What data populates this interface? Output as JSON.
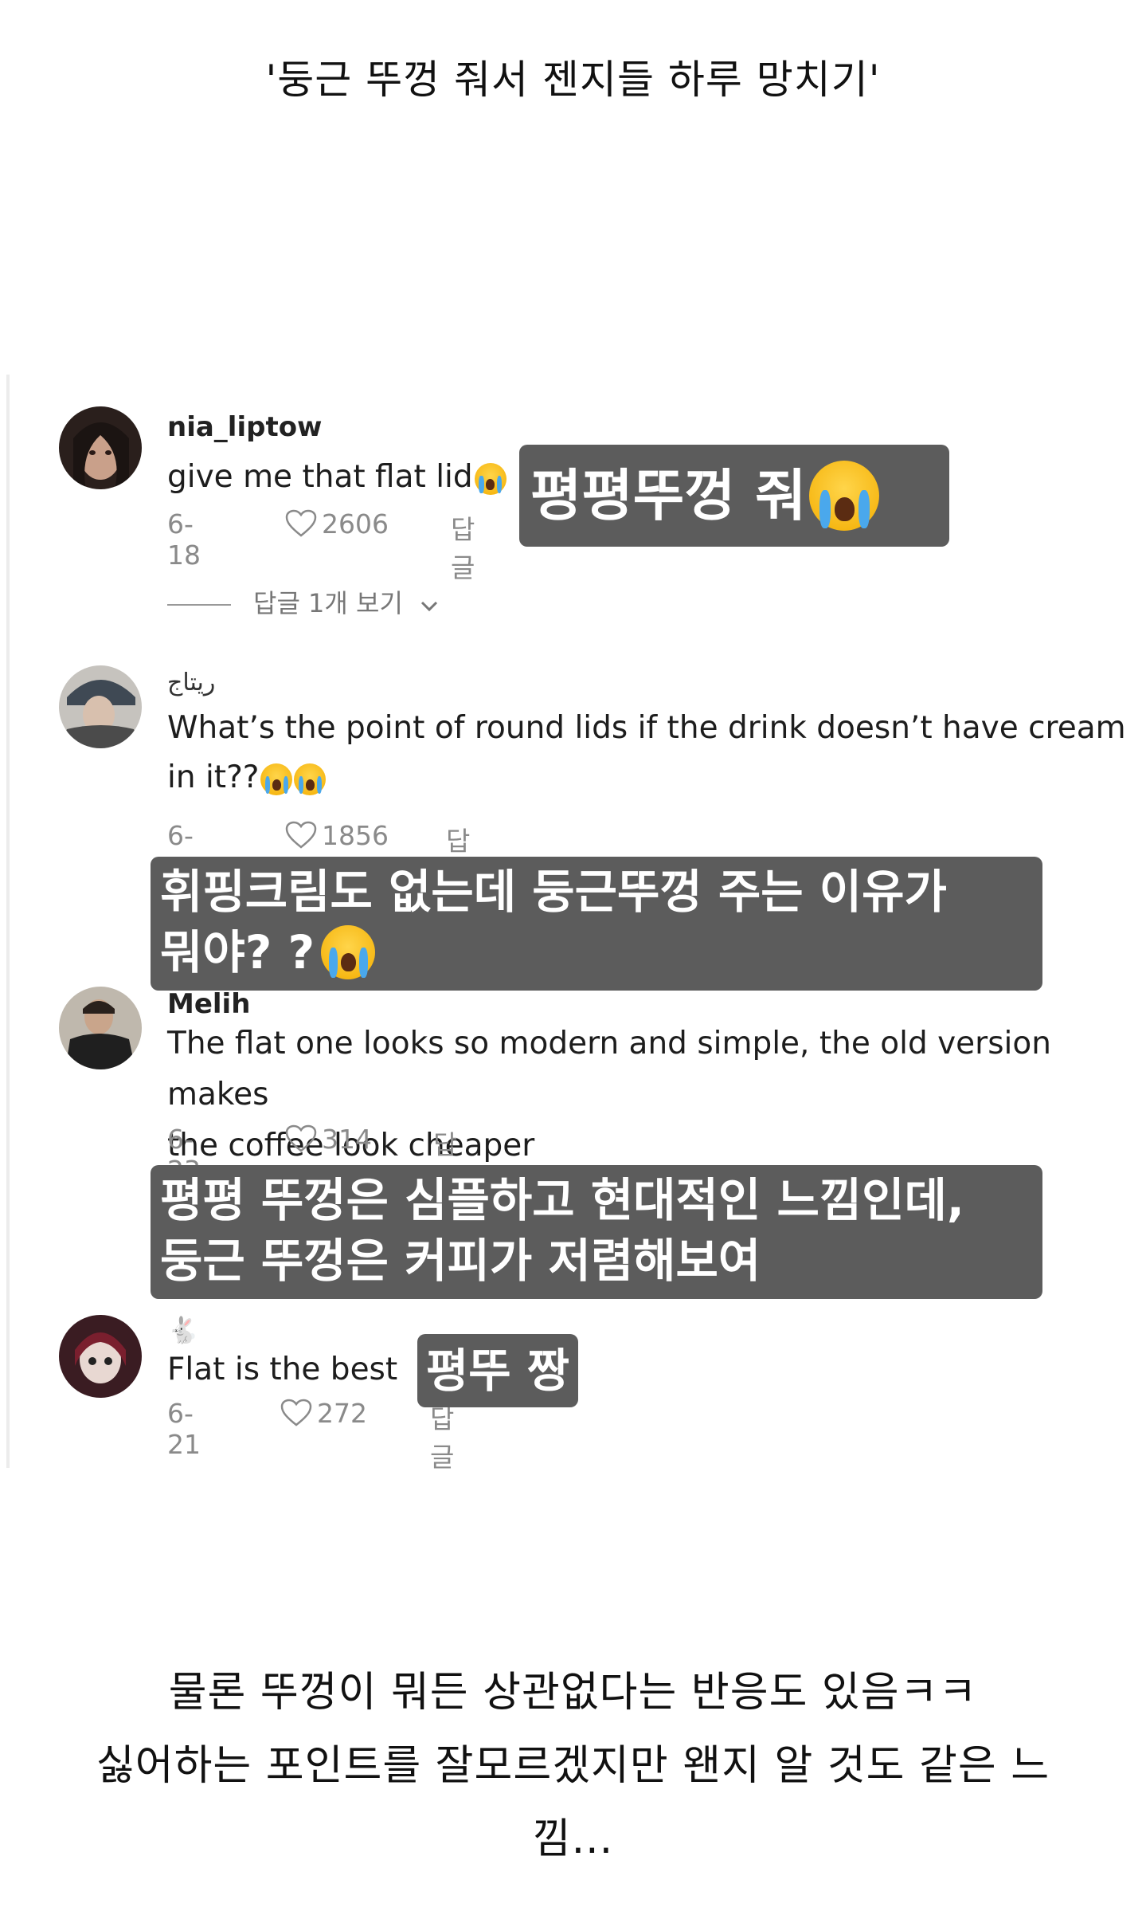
{
  "header": {
    "caption": "'둥근 뚜껑 줘서 젠지들 하루 망치기'"
  },
  "comments": [
    {
      "username": "nia_liptow",
      "text": "give me that flat lid",
      "date": "6-18",
      "likes": "2606",
      "reply_label": "답글",
      "view_replies": "답글 1개 보기",
      "overlay": "평평뚜껑 줘"
    },
    {
      "username": "ريتاج",
      "text": "What’s the point of round lids if the drink doesn’t have cream in it??",
      "date": "6-14",
      "likes": "1856",
      "reply_label": "답글",
      "overlay_line1": "휘핑크림도 없는데 둥근뚜껑 주는 이유가",
      "overlay_line2": "뭐야? ?"
    },
    {
      "username": "Melih",
      "text_line1": "The flat one looks so modern and simple, the old version makes",
      "text_line2": "the coffee look cheaper",
      "date": "6-23",
      "likes": "314",
      "reply_label": "답글",
      "overlay_line1": "평평 뚜껑은 심플하고 현대적인 느낌인데,",
      "overlay_line2": "둥근 뚜껑은 커피가 저렴해보여"
    },
    {
      "username": "🐇",
      "text": "Flat is the best",
      "date": "6-21",
      "likes": "272",
      "reply_label": "답글",
      "overlay": "평뚜 짱"
    }
  ],
  "footer": {
    "line1": "물론 뚜껑이 뭐든 상관없다는 반응도 있음ㅋㅋ",
    "line2": "싫어하는 포인트를 잘모르겠지만 왠지 알 것도 같은 느",
    "line3": "낌..."
  },
  "colors": {
    "overlay_bg": "#5c5c5c",
    "meta_gray": "#8a8a8a"
  }
}
